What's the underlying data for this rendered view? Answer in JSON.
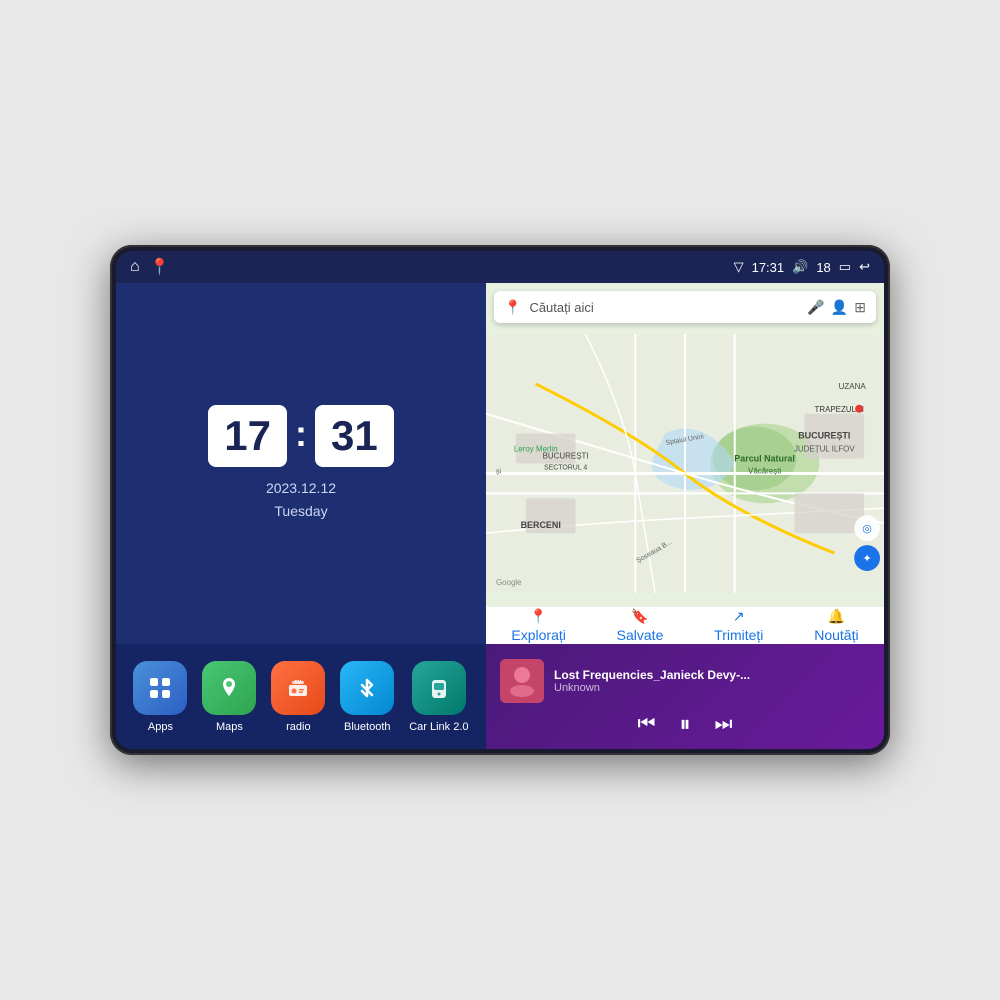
{
  "device": {
    "status_bar": {
      "left_icons": [
        "home-icon",
        "maps-pin-icon"
      ],
      "signal_icon": "▽",
      "time": "17:31",
      "volume_icon": "🔊",
      "battery_level": "18",
      "battery_icon": "🔋",
      "back_icon": "↩"
    },
    "clock": {
      "hours": "17",
      "minutes": "31",
      "date": "2023.12.12",
      "day": "Tuesday"
    },
    "app_icons": [
      {
        "id": "apps",
        "label": "Apps",
        "icon": "⊞",
        "class": "icon-apps"
      },
      {
        "id": "maps",
        "label": "Maps",
        "icon": "📍",
        "class": "icon-maps"
      },
      {
        "id": "radio",
        "label": "radio",
        "icon": "📻",
        "class": "icon-radio"
      },
      {
        "id": "bluetooth",
        "label": "Bluetooth",
        "icon": "⦿",
        "class": "icon-bluetooth"
      },
      {
        "id": "carlink",
        "label": "Car Link 2.0",
        "icon": "📱",
        "class": "icon-carlink"
      }
    ],
    "map": {
      "search_placeholder": "Căutați aici",
      "location": "București",
      "subtitle": "JUDEȚUL ILFOV",
      "landmark": "Parcul Natural Văcărești",
      "area1": "BERCENI",
      "area2": "BUCUREȘTI SECTORUL 4",
      "street1": "Leroy Merlin",
      "nav_items": [
        {
          "icon": "📍",
          "label": "Explorați"
        },
        {
          "icon": "🔖",
          "label": "Salvate"
        },
        {
          "icon": "↗",
          "label": "Trimiteți"
        },
        {
          "icon": "🔔",
          "label": "Noutăți"
        }
      ]
    },
    "music": {
      "title": "Lost Frequencies_Janieck Devy-...",
      "artist": "Unknown",
      "controls": {
        "prev": "⏮",
        "play": "⏸",
        "next": "⏭"
      }
    }
  }
}
